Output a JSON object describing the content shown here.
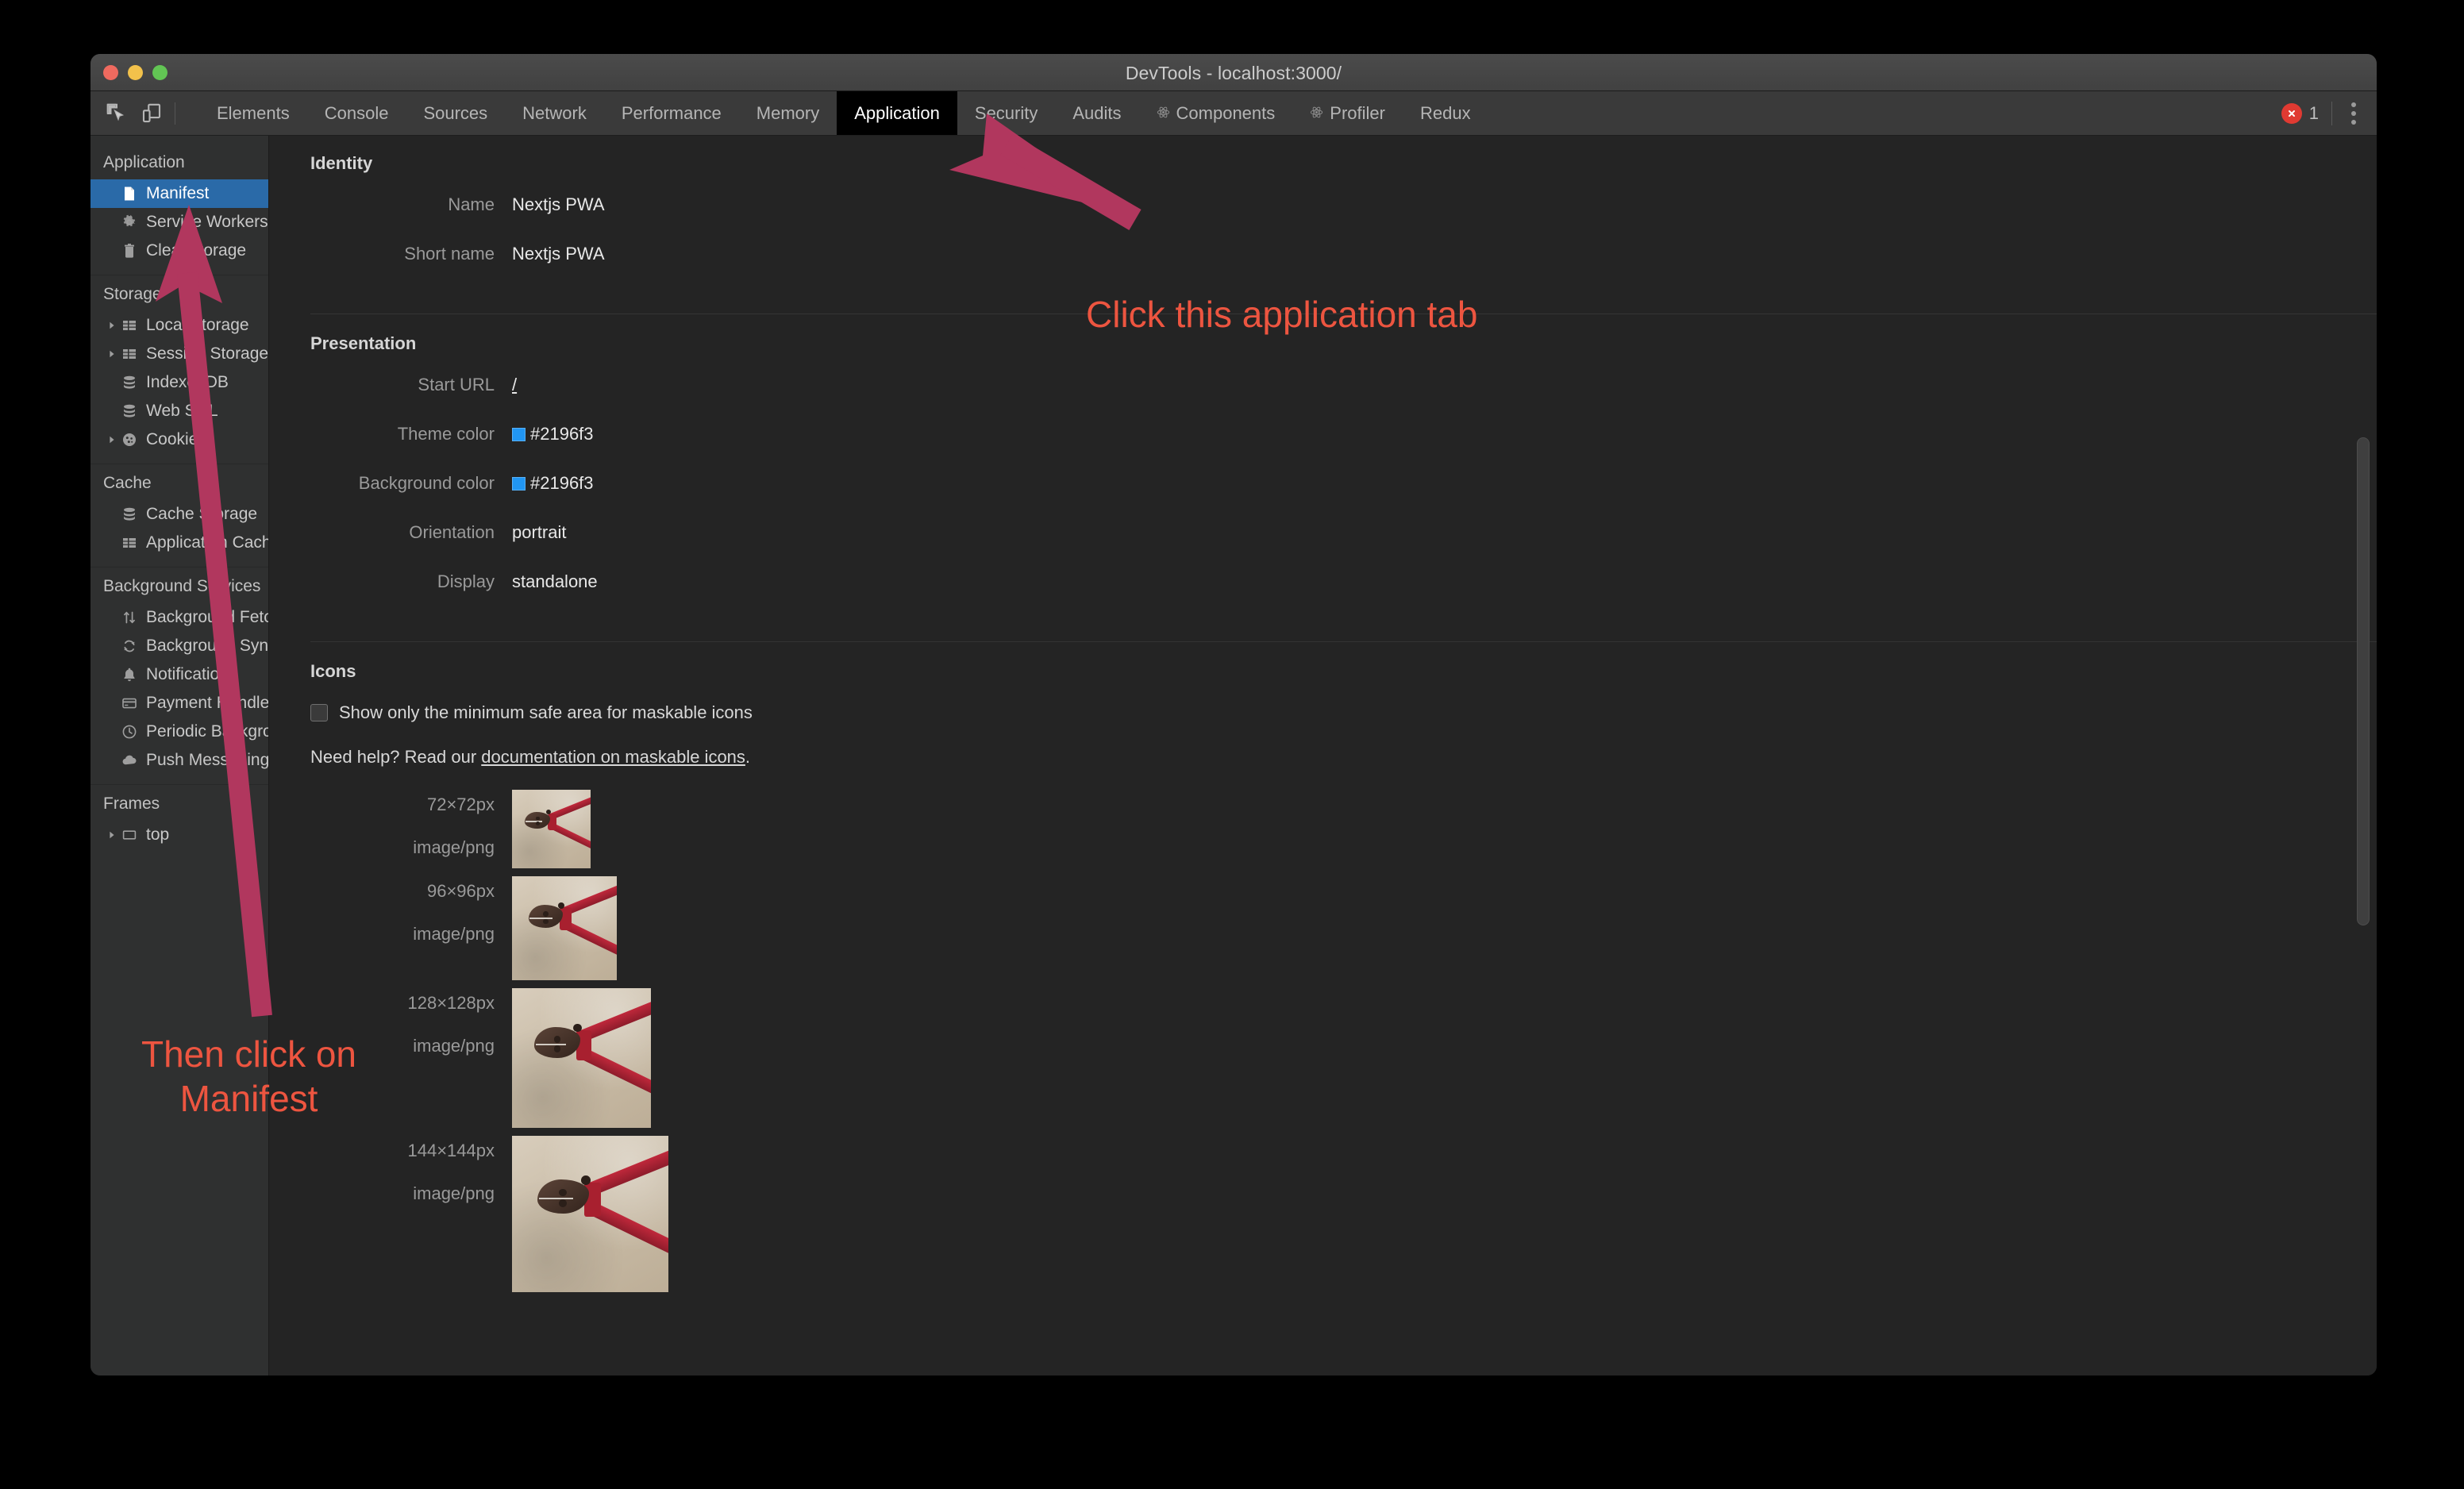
{
  "window": {
    "title": "DevTools - localhost:3000/",
    "traffic_lights": [
      "close",
      "minimize",
      "zoom"
    ]
  },
  "toolbar": {
    "left_icons": [
      {
        "name": "inspect-element-icon",
        "label": "Inspect element"
      },
      {
        "name": "device-toolbar-icon",
        "label": "Toggle device toolbar"
      }
    ],
    "tabs": [
      {
        "label": "Elements",
        "active": false,
        "icon": null
      },
      {
        "label": "Console",
        "active": false,
        "icon": null
      },
      {
        "label": "Sources",
        "active": false,
        "icon": null
      },
      {
        "label": "Network",
        "active": false,
        "icon": null
      },
      {
        "label": "Performance",
        "active": false,
        "icon": null
      },
      {
        "label": "Memory",
        "active": false,
        "icon": null
      },
      {
        "label": "Application",
        "active": true,
        "icon": null
      },
      {
        "label": "Security",
        "active": false,
        "icon": null
      },
      {
        "label": "Audits",
        "active": false,
        "icon": null
      },
      {
        "label": "Components",
        "active": false,
        "icon": "react-atom-icon"
      },
      {
        "label": "Profiler",
        "active": false,
        "icon": "react-atom-icon"
      },
      {
        "label": "Redux",
        "active": false,
        "icon": null
      }
    ],
    "error_count": "1",
    "error_icon": "error-circle-icon",
    "menu_icon": "kebab-menu-icon"
  },
  "sidebar": {
    "groups": [
      {
        "title": "Application",
        "items": [
          {
            "label": "Manifest",
            "icon": "document-icon",
            "selected": true,
            "twisty": false
          },
          {
            "label": "Service Workers",
            "icon": "gear-icon",
            "selected": false,
            "twisty": false
          },
          {
            "label": "Clear storage",
            "icon": "trash-icon",
            "selected": false,
            "twisty": false
          }
        ]
      },
      {
        "title": "Storage",
        "items": [
          {
            "label": "Local Storage",
            "icon": "table-icon",
            "selected": false,
            "twisty": true
          },
          {
            "label": "Session Storage",
            "icon": "table-icon",
            "selected": false,
            "twisty": true
          },
          {
            "label": "IndexedDB",
            "icon": "database-icon",
            "selected": false,
            "twisty": false
          },
          {
            "label": "Web SQL",
            "icon": "database-icon",
            "selected": false,
            "twisty": false
          },
          {
            "label": "Cookies",
            "icon": "cookie-icon",
            "selected": false,
            "twisty": true
          }
        ]
      },
      {
        "title": "Cache",
        "items": [
          {
            "label": "Cache Storage",
            "icon": "database-icon",
            "selected": false,
            "twisty": false
          },
          {
            "label": "Application Cache",
            "icon": "table-icon",
            "selected": false,
            "twisty": false
          }
        ]
      },
      {
        "title": "Background Services",
        "items": [
          {
            "label": "Background Fetch",
            "icon": "updown-arrows-icon",
            "selected": false,
            "twisty": false
          },
          {
            "label": "Background Sync",
            "icon": "sync-icon",
            "selected": false,
            "twisty": false
          },
          {
            "label": "Notifications",
            "icon": "bell-icon",
            "selected": false,
            "twisty": false
          },
          {
            "label": "Payment Handler",
            "icon": "credit-card-icon",
            "selected": false,
            "twisty": false
          },
          {
            "label": "Periodic Background Sy",
            "icon": "clock-icon",
            "selected": false,
            "twisty": false
          },
          {
            "label": "Push Messaging",
            "icon": "cloud-icon",
            "selected": false,
            "twisty": false
          }
        ]
      },
      {
        "title": "Frames",
        "items": [
          {
            "label": "top",
            "icon": "frame-icon",
            "selected": false,
            "twisty": true
          }
        ]
      }
    ]
  },
  "manifest": {
    "identity": {
      "title": "Identity",
      "fields": [
        {
          "label": "Name",
          "value": "Nextjs PWA",
          "type": "text"
        },
        {
          "label": "Short name",
          "value": "Nextjs PWA",
          "type": "text"
        }
      ]
    },
    "presentation": {
      "title": "Presentation",
      "fields": [
        {
          "label": "Start URL",
          "value": "/",
          "type": "link"
        },
        {
          "label": "Theme color",
          "value": "#2196f3",
          "type": "color",
          "swatch": "#2196f3"
        },
        {
          "label": "Background color",
          "value": "#2196f3",
          "type": "color",
          "swatch": "#2196f3"
        },
        {
          "label": "Orientation",
          "value": "portrait",
          "type": "text"
        },
        {
          "label": "Display",
          "value": "standalone",
          "type": "text"
        }
      ]
    },
    "icons": {
      "title": "Icons",
      "checkbox_label": "Show only the minimum safe area for maskable icons",
      "checkbox_checked": false,
      "help_prefix": "Need help? Read our ",
      "help_link": "documentation on maskable icons",
      "help_suffix": ".",
      "entries": [
        {
          "size": "72×72px",
          "mime": "image/png",
          "px": 72
        },
        {
          "size": "96×96px",
          "mime": "image/png",
          "px": 96
        },
        {
          "size": "128×128px",
          "mime": "image/png",
          "px": 128
        },
        {
          "size": "144×144px",
          "mime": "image/png",
          "px": 144
        }
      ]
    }
  },
  "annotations": [
    {
      "text": "Click this application tab",
      "color": "#ed5540",
      "target": "Application tab"
    },
    {
      "text": "Then click on\nManifest",
      "color": "#ed5540",
      "target": "Manifest sidebar item"
    }
  ],
  "colors": {
    "arrow": "#b1375e",
    "annotation_text": "#ed5540",
    "selection_blue": "#2a6aa8",
    "panel_bg": "#242424",
    "sidebar_bg": "#2f3030",
    "error_red": "#e03a32"
  }
}
